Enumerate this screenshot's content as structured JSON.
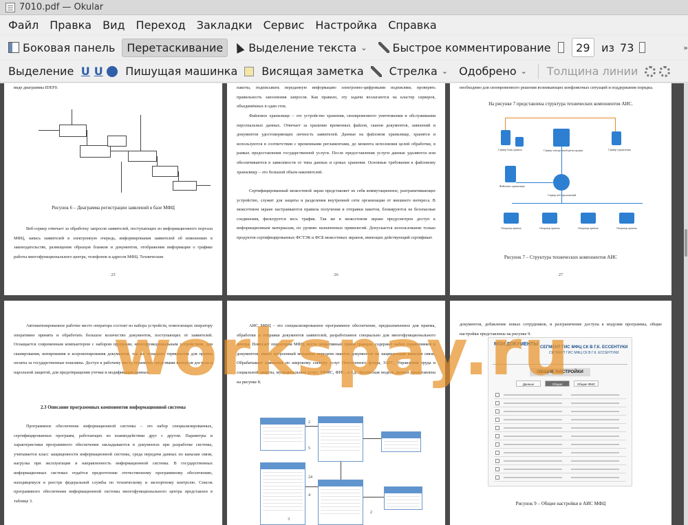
{
  "window": {
    "title": "7010.pdf — Okular"
  },
  "menu": [
    "Файл",
    "Правка",
    "Вид",
    "Переход",
    "Закладки",
    "Сервис",
    "Настройка",
    "Справка"
  ],
  "toolbar1": {
    "sidebar": "Боковая панель",
    "drag": "Перетаскивание",
    "text_select": "Выделение текста",
    "quick_comment": "Быстрое комментирование",
    "current_page": "29",
    "of": "из",
    "total_pages": "73"
  },
  "toolbar2": {
    "highlight": "Выделение",
    "typewriter": "Пишущая машинка",
    "inline_note": "Висящая заметка",
    "arrow": "Стрелка",
    "approved": "Одобрено",
    "line_width": "Толщина линии"
  },
  "pages": {
    "p1": {
      "top_line": "виде диаграммы IDEF0.",
      "caption": "Рисунок 6 – Диаграмма регистрации заявлений в базе МФЦ",
      "para": "Веб-сервер отвечает за обработку запросов заявителей, поступающих из информационного портала МФЦ, запись заявителей в электронную очередь, информирования заявителей об изменениях в законодательстве, размещения образцов бланков и документов, отображения информации о графике работы многофункционального центра, телефонов и адресов МФЦ. Технические",
      "number": "25"
    },
    "p2": {
      "para1": "пакеты, подписывать переданную информацию электронно-цифровыми подписями, проверять правильность заполнения запросов. Как правило, эту задачи возлагаются на кластер серверов, объединённых в один стек.",
      "para2": "Файловое хранилище – это устройство хранения, своевременного уничтожения и обслуживания персональных данных. Отвечает за хранение временных файлов, сканов документов, заявлений и документов удостоверяющих личность заявителей. Данные на файловом хранилище, хранятся и используются в соответствии с временными регламентами, до момента исполнения целей обработки, в рамках предоставления государственной услуги. После предоставления услуги данные удаляются или обезличиваются в зависимости от типа данных и сроках хранения. Основные требования к файловому хранилищу – это большой объем накопителей.",
      "para3": "Сертифицированный межсетевой экран представляет из себя коммутационное, разграничивающее устройство, служит для защиты и разделения внутренней сети организации от внешнего интереса. В межсетевом экране настраиваются правила получения и отправки пакетов, блокируются не безопасные соединения, фильтруется весь трафик. Так же в межсетевом экране предусмотрен доступ к информационным материалам, по уровню назначенных привилегий. Допускается использование только продуктов сертифицированных ФСТЭК и ФСБ межсетевых экранов, имеющих действующий сертификат.",
      "number": "26"
    },
    "p3": {
      "para1": "необходимо для своевременного решения возникающих конфликтных ситуаций и поддержания порядка.",
      "para2": "На рисунке 7 представлена структура технических компонентов АИС.",
      "label_files": "Сервер базы данных",
      "label_reg": "Сервер электронной регистрации",
      "label_control": "Сервер управления",
      "label_store": "Файловое хранилище",
      "label_web": "Сервер веб-приложений",
      "label_op": "Оператор приема",
      "caption": "Рисунок 7 – Структура технических компонентов АИС",
      "number": "27"
    },
    "p4": {
      "para1": "Автоматизированное рабочее место оператора состоит из набора устройств, помогающих оператору оперативно принять и обработать большое количество документов, поступающих от заявителей. Оснащается современным компьютером с набором программ, многофункциональным устройством, для сканирования, копирования и ксерокопирования документов, так же оснащено терминалом для приема оплаты за государственные пошлины. Доступ к рабочему месту ограничен средствами контроля доступа и парольной защитой, для предотвращения утечки и модификации данных.",
      "heading": "2.3 Описание программных компонентов информационной системы",
      "para2": "Программное обеспечение информационной системы – это набор специализированных, сертифицированных программ, работающих во взаимодействии друг с другом. Параметры и характеристики программного обеспечения закладываются в документах при разработке системы, учитывается класс защищенности информационной системы, среда передачи данных по каналам связи, нагрузка при эксплуатации и направленность информационной системы. В государственных информационных системах отдаётся предпочтение отечественному программному обеспечению, находящемуся в реестре федеральной службы по техническому и экспортному контролю. Список программного обеспечения информационной системы многофункционального центра представлен в таблице 3."
    },
    "p5": {
      "para": "АИС МФЦ - это специализированное программное обеспечение, предназначенное для приема, обработки и отправки документов заявителей, разработанное специально для многофункционального центра. Помогает операторам МФЦ, вести оперативный прием граждан, содержит набор справочников и документов, имеет встроенный механизм передачи пакетов документов по защищенным каналам связи. Обрабатывает заявления по широкому спектру услуг Пенсионного фонда, ЗАГС, Управления труда и социальной защиты, муниципальных услуг, УФМС, ФНС, и т.д. Логическая модель данных представлена на рисунке 8.",
      "edge_a": "2",
      "edge_b": "5",
      "edge_c": "24",
      "edge_d": "4",
      "edge_e": "2",
      "edge_f": "3"
    },
    "p6": {
      "para": "документов, добавление новых сотрудников, и разграничение доступа к модулям программы, общие настройки представлены на рисунке 9.",
      "logo": "МОИ ДОКУМЕНТЫ",
      "shot_title": "СЕГМЕНТ ГИС МФЦ СК В Г.К. ЕССЕНТУКИ",
      "shot_subtitle": "СЕГМЕНТ ГИС МФЦ СК В Г.К. ЕССЕНТУКИ",
      "settings": "ОБЩИЕ НАСТРОЙКИ",
      "tab1": "Данные",
      "tab2": "Общие",
      "tab3": "Общие ФМС",
      "caption": "Рисунок 9 – Общие настройки в АИС МФЦ"
    }
  },
  "watermark": "workspay.ru"
}
